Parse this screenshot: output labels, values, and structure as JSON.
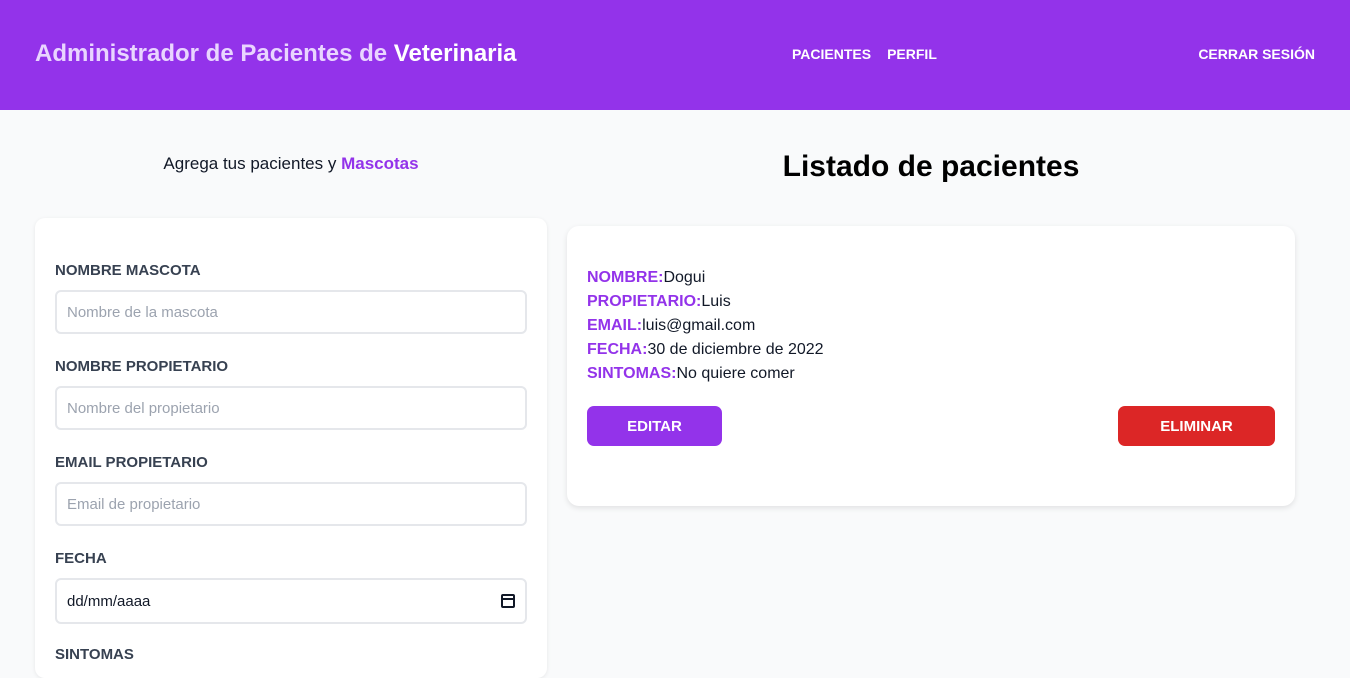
{
  "header": {
    "brand_prefix": "Administrador de Pacientes de",
    "brand_accent": "Veterinaria",
    "nav": [
      "Pacientes",
      "Perfil"
    ],
    "logout_label": "Cerrar Sesión"
  },
  "form_section": {
    "subtitle_prefix": "Agrega tus pacientes y",
    "subtitle_accent": "Mascotas",
    "fields": [
      {
        "label": "Nombre Mascota",
        "placeholder": "Nombre de la mascota"
      },
      {
        "label": "Nombre Propietario",
        "placeholder": "Nombre del propietario"
      },
      {
        "label": "Email Propietario",
        "placeholder": "Email de propietario"
      },
      {
        "label": "Fecha",
        "value": "dd/mm/aaaa"
      },
      {
        "label": "Sintomas"
      }
    ]
  },
  "list_section": {
    "title": "Listado de pacientes",
    "patient": {
      "name_key": "Nombre:",
      "name": "Dogui",
      "owner_key": "Propietario:",
      "owner": "Luis",
      "email_key": "Email:",
      "email": "luis@gmail.com",
      "date_key": "Fecha:",
      "date": "30 de diciembre de 2022",
      "symptoms_key": "Sintomas:",
      "symptoms": "No quiere comer"
    },
    "edit_label": "Editar",
    "delete_label": "Eliminar"
  },
  "colors": {
    "brand": "#9333ea",
    "danger": "#dc2626",
    "background": "#f9fafb"
  }
}
